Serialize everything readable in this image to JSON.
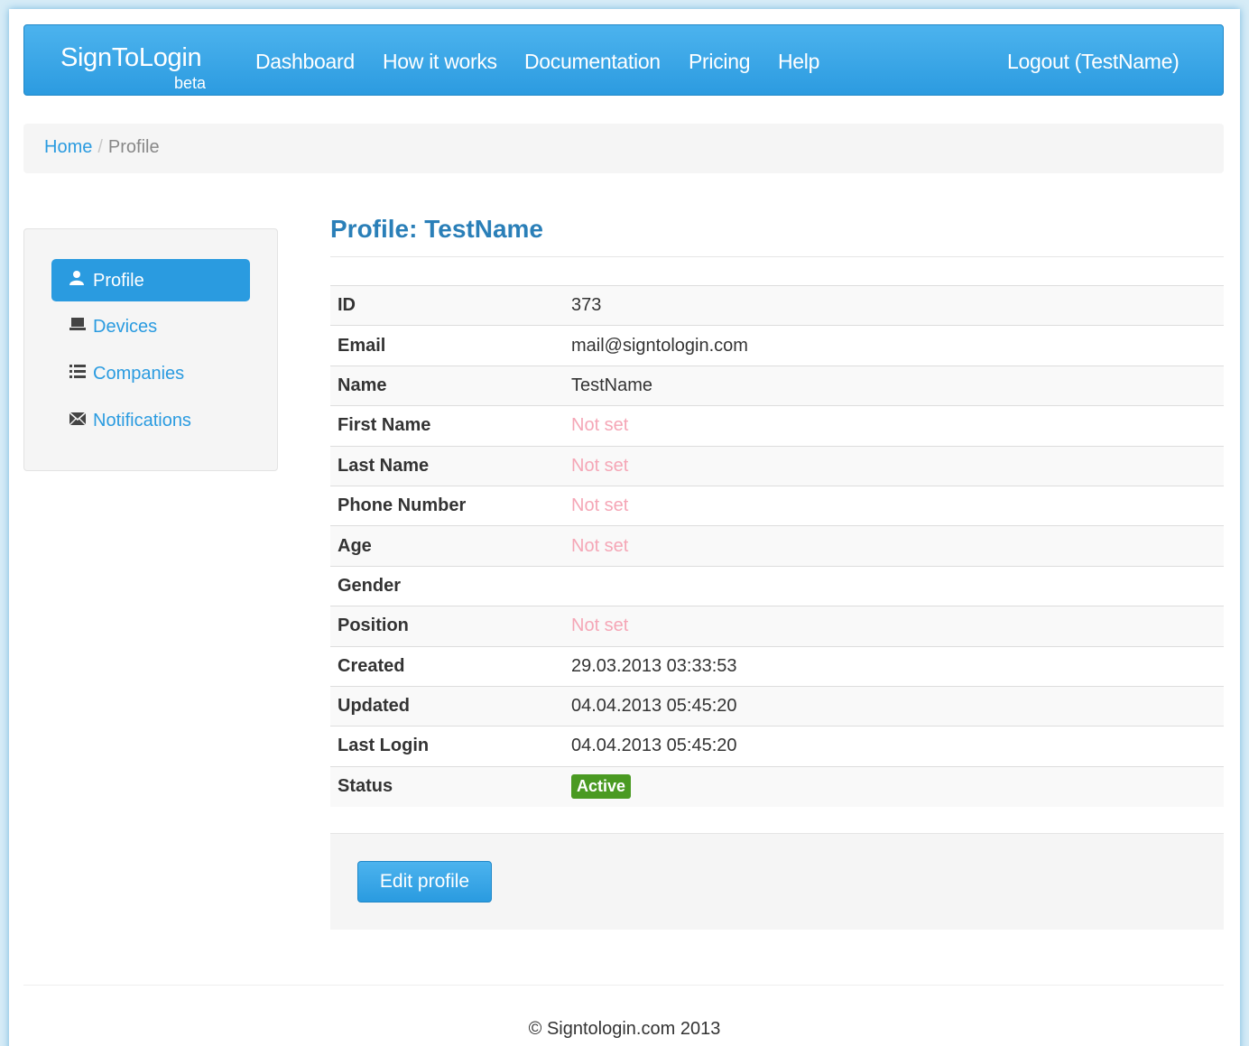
{
  "navbar": {
    "brand": "SignToLogin",
    "brand_sub": "beta",
    "items": [
      {
        "label": "Dashboard"
      },
      {
        "label": "How it works"
      },
      {
        "label": "Documentation"
      },
      {
        "label": "Pricing"
      },
      {
        "label": "Help"
      }
    ],
    "logout": "Logout (TestName)"
  },
  "breadcrumb": {
    "home": "Home",
    "separator": "/",
    "current": "Profile"
  },
  "sidebar": {
    "items": [
      {
        "label": "Profile",
        "icon": "user-icon",
        "active": true
      },
      {
        "label": "Devices",
        "icon": "laptop-icon"
      },
      {
        "label": "Companies",
        "icon": "list-icon"
      },
      {
        "label": "Notifications",
        "icon": "envelope-icon"
      }
    ]
  },
  "profile": {
    "title": "Profile: TestName",
    "rows": [
      {
        "label": "ID",
        "value": "373"
      },
      {
        "label": "Email",
        "value": "mail@signtologin.com"
      },
      {
        "label": "Name",
        "value": "TestName"
      },
      {
        "label": "First Name",
        "value": "Not set"
      },
      {
        "label": "Last Name",
        "value": "Not set"
      },
      {
        "label": "Phone Number",
        "value": "Not set"
      },
      {
        "label": "Age",
        "value": "Not set"
      },
      {
        "label": "Gender",
        "value": ""
      },
      {
        "label": "Position",
        "value": "Not set"
      },
      {
        "label": "Created",
        "value": "29.03.2013 03:33:53"
      },
      {
        "label": "Updated",
        "value": "04.04.2013 05:45:20"
      },
      {
        "label": "Last Login",
        "value": "04.04.2013 05:45:20"
      },
      {
        "label": "Status",
        "value": "Active"
      }
    ],
    "edit_button": "Edit profile"
  },
  "footer": {
    "text": "© Signtologin.com 2013"
  },
  "colors": {
    "accent": "#2a9be0",
    "not_set": "#f5a6b6",
    "status_active": "#4a9a22",
    "title": "#2a7fb8"
  }
}
